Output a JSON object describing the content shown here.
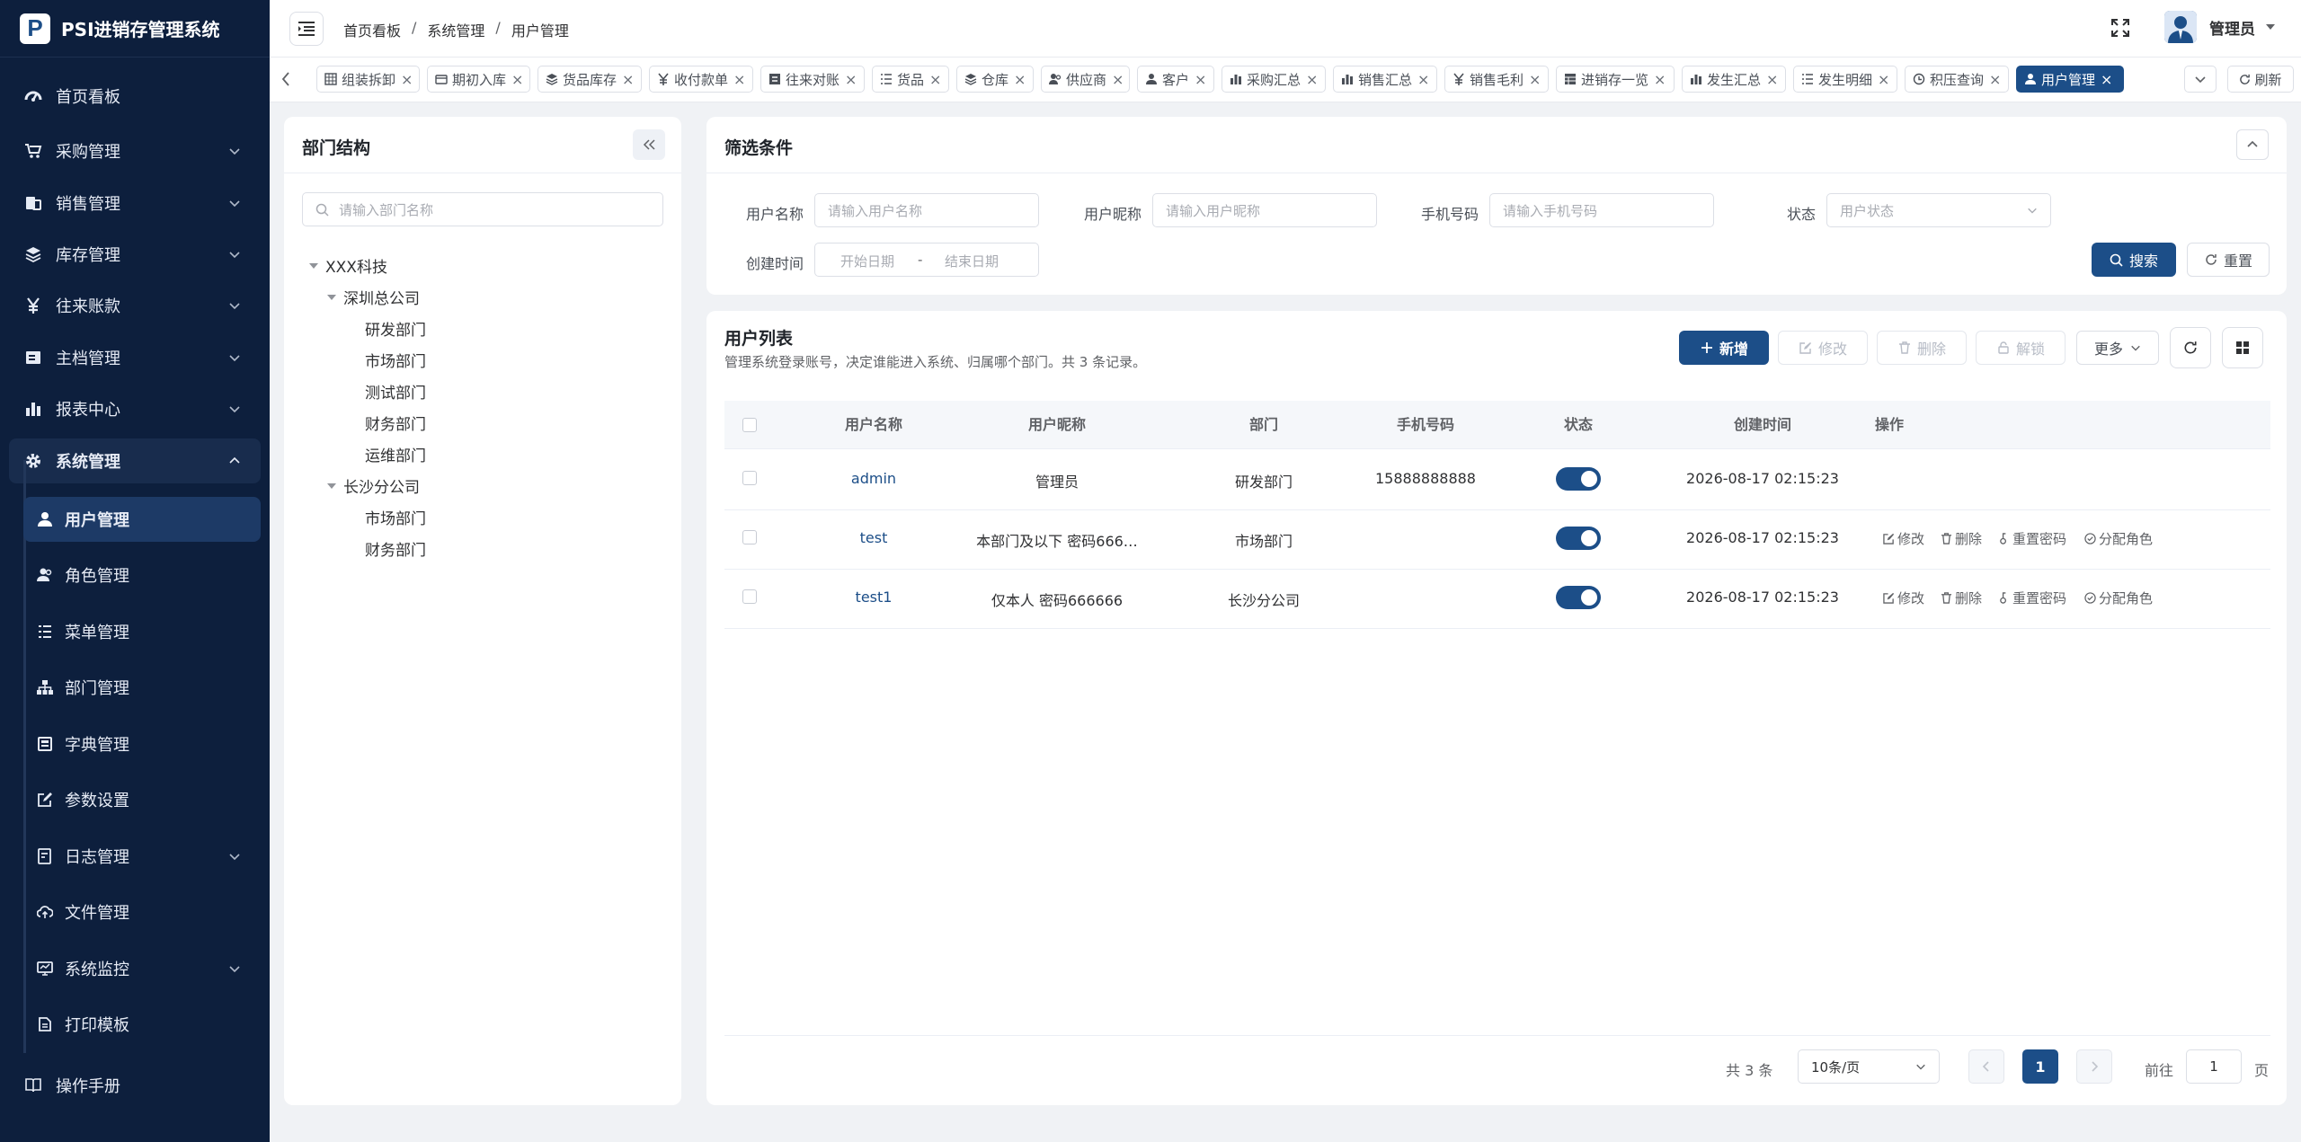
{
  "app": {
    "title": "PSI进销存管理系统",
    "logo_letter": "P"
  },
  "sidebar": {
    "items": [
      {
        "label": "首页看板",
        "icon": "dashboard-icon"
      },
      {
        "label": "采购管理",
        "icon": "cart-icon"
      },
      {
        "label": "销售管理",
        "icon": "sales-icon"
      },
      {
        "label": "库存管理",
        "icon": "layers-icon"
      },
      {
        "label": "往来账款",
        "icon": "yen-icon"
      },
      {
        "label": "主档管理",
        "icon": "archive-icon"
      },
      {
        "label": "报表中心",
        "icon": "bar-chart-icon"
      },
      {
        "label": "系统管理",
        "icon": "gear-icon"
      }
    ],
    "sub_items": [
      {
        "label": "用户管理",
        "icon": "user-icon"
      },
      {
        "label": "角色管理",
        "icon": "role-icon"
      },
      {
        "label": "菜单管理",
        "icon": "menu-list-icon"
      },
      {
        "label": "部门管理",
        "icon": "org-icon"
      },
      {
        "label": "字典管理",
        "icon": "dict-icon"
      },
      {
        "label": "参数设置",
        "icon": "edit-icon"
      },
      {
        "label": "日志管理",
        "icon": "log-icon"
      },
      {
        "label": "文件管理",
        "icon": "cloud-icon"
      },
      {
        "label": "系统监控",
        "icon": "monitor-icon"
      },
      {
        "label": "打印模板",
        "icon": "print-icon"
      }
    ],
    "footer_label": "操作手册"
  },
  "header": {
    "breadcrumb": [
      "首页看板",
      "系统管理",
      "用户管理"
    ],
    "separator": "/",
    "user_name": "管理员"
  },
  "tabs": [
    {
      "label": "组装拆卸",
      "icon": "grid-icon"
    },
    {
      "label": "期初入库",
      "icon": "card-icon"
    },
    {
      "label": "货品库存",
      "icon": "layers-icon"
    },
    {
      "label": "收付款单",
      "icon": "yen-icon"
    },
    {
      "label": "往来对账",
      "icon": "doc-icon"
    },
    {
      "label": "货品",
      "icon": "list-icon"
    },
    {
      "label": "仓库",
      "icon": "layers-icon"
    },
    {
      "label": "供应商",
      "icon": "role-icon"
    },
    {
      "label": "客户",
      "icon": "user-icon"
    },
    {
      "label": "采购汇总",
      "icon": "bar-chart-icon"
    },
    {
      "label": "销售汇总",
      "icon": "bar-chart-icon"
    },
    {
      "label": "销售毛利",
      "icon": "yen-icon"
    },
    {
      "label": "进销存一览",
      "icon": "table-icon"
    },
    {
      "label": "发生汇总",
      "icon": "bar-chart-icon"
    },
    {
      "label": "发生明细",
      "icon": "list-icon"
    },
    {
      "label": "积压查询",
      "icon": "clock-icon"
    },
    {
      "label": "用户管理",
      "icon": "user-icon"
    }
  ],
  "tabs_close": "×",
  "tabs_refresh": "刷新",
  "dept": {
    "title": "部门结构",
    "search_placeholder": "请输入部门名称",
    "tree": {
      "root": "XXX科技",
      "group1": "深圳总公司",
      "group1_children": [
        "研发部门",
        "市场部门",
        "测试部门",
        "财务部门",
        "运维部门"
      ],
      "group2": "长沙分公司",
      "group2_children": [
        "市场部门",
        "财务部门"
      ]
    }
  },
  "filter": {
    "title": "筛选条件",
    "username_label": "用户名称",
    "username_placeholder": "请输入用户名称",
    "nickname_label": "用户昵称",
    "nickname_placeholder": "请输入用户昵称",
    "phone_label": "手机号码",
    "phone_placeholder": "请输入手机号码",
    "status_label": "状态",
    "status_placeholder": "用户状态",
    "created_label": "创建时间",
    "start_placeholder": "开始日期",
    "range_sep": "-",
    "end_placeholder": "结束日期",
    "search_btn": "搜索",
    "reset_btn": "重置"
  },
  "list": {
    "title": "用户列表",
    "subtitle": "管理系统登录账号，决定谁能进入系统、归属哪个部门。共 3 条记录。",
    "add_btn": "新增",
    "edit_btn": "修改",
    "delete_btn": "删除",
    "unlock_btn": "解锁",
    "more_btn": "更多",
    "columns": [
      "用户名称",
      "用户昵称",
      "部门",
      "手机号码",
      "状态",
      "创建时间",
      "操作"
    ],
    "rows": [
      {
        "username": "admin",
        "nickname": "管理员",
        "dept": "研发部门",
        "phone": "15888888888",
        "status": true,
        "created": "2026-08-17 02:15:23",
        "actions": []
      },
      {
        "username": "test",
        "nickname": "本部门及以下 密码666…",
        "dept": "市场部门",
        "phone": "",
        "status": true,
        "created": "2026-08-17 02:15:23",
        "actions": [
          "修改",
          "删除",
          "重置密码",
          "分配角色"
        ]
      },
      {
        "username": "test1",
        "nickname": "仅本人 密码666666",
        "dept": "长沙分公司",
        "phone": "",
        "status": true,
        "created": "2026-08-17 02:15:23",
        "actions": [
          "修改",
          "删除",
          "重置密码",
          "分配角色"
        ]
      }
    ]
  },
  "pagination": {
    "total": "共 3 条",
    "page_size": "10条/页",
    "current": "1",
    "goto_label": "前往",
    "goto_value": "1",
    "page_suffix": "页"
  },
  "colors": {
    "sidebar_bg": "#0d1f3d",
    "primary": "#1c4e88",
    "page_bg": "#f0f2f5"
  }
}
